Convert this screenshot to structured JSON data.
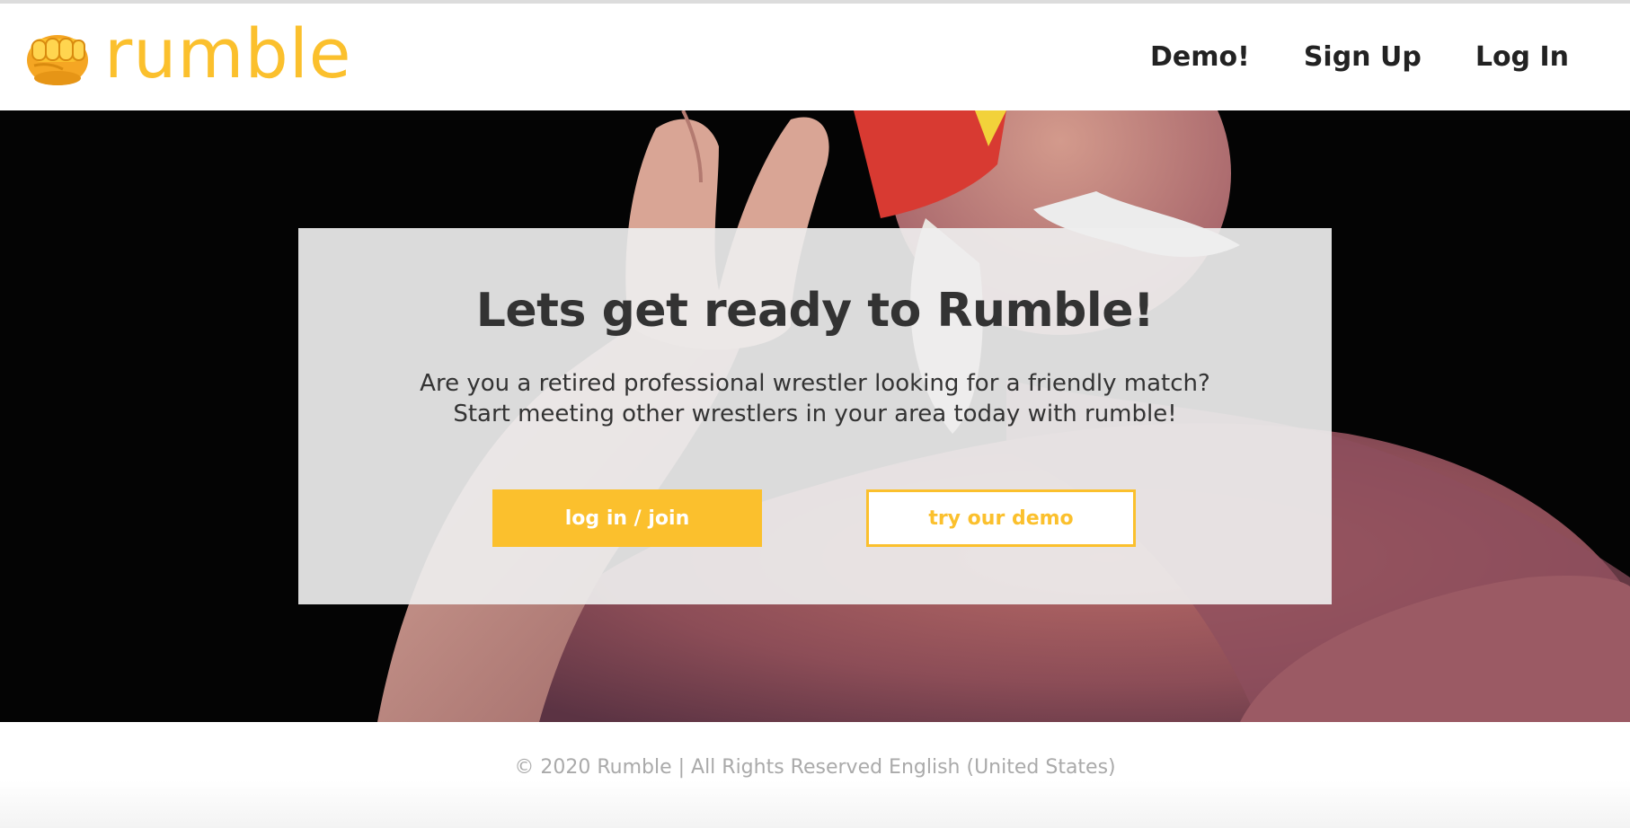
{
  "brand": {
    "name": "rumble",
    "color": "#fbc02d"
  },
  "nav": {
    "items": [
      "Demo!",
      "Sign Up",
      "Log In"
    ]
  },
  "hero": {
    "title": "Lets get ready to Rumble!",
    "line1": "Are you a retired professional wrestler looking for a friendly match?",
    "line2": "Start meeting other wrestlers in your area today with rumble!",
    "login_button": "log in / join",
    "demo_button": "try our demo"
  },
  "footer": {
    "text": "© 2020 Rumble | All Rights Reserved English (United States)"
  },
  "icons": {
    "logo": "fist-icon"
  }
}
